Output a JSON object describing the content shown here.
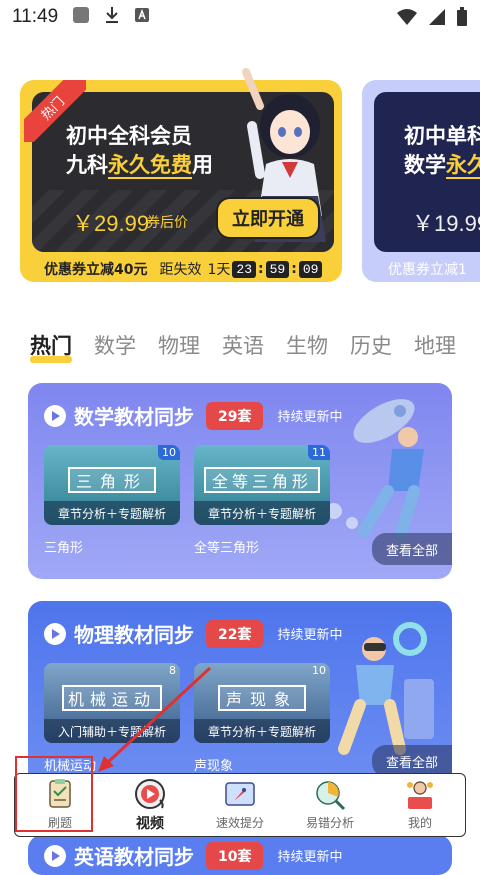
{
  "status": {
    "time": "11:49"
  },
  "membership": {
    "main": {
      "tag": "热门",
      "title_line1": "初中全科会员",
      "title_line2_prefix": "九科",
      "title_line2_highlight": "永久免费",
      "title_line2_suffix": "用",
      "price": "￥29.99",
      "price_note": "券后价",
      "button": "立即开通",
      "coupon": "优惠券立减40元",
      "expire_label": "距失效",
      "countdown_day": "1天",
      "countdown_h": "23",
      "countdown_m": "59",
      "countdown_s": "09"
    },
    "second": {
      "title_line1": "初中单科",
      "title_line2_prefix": "数学",
      "title_line2_highlight": "永久",
      "price": "￥19.99",
      "coupon": "优惠券立减1"
    }
  },
  "tabs": [
    "热门",
    "数学",
    "物理",
    "英语",
    "生物",
    "历史",
    "地理"
  ],
  "sections": {
    "math": {
      "title": "数学教材同步",
      "count": "29套",
      "update": "持续更新中",
      "items": [
        {
          "thumb_title": "三角形",
          "num": "10",
          "sub": "章节分析＋专题解析",
          "label": "三角形"
        },
        {
          "thumb_title": "全等三角形",
          "num": "11",
          "sub": "章节分析＋专题解析",
          "label": "全等三角形"
        }
      ],
      "view_all": "查看全部"
    },
    "physics": {
      "title": "物理教材同步",
      "count": "22套",
      "update": "持续更新中",
      "items": [
        {
          "thumb_title": "机械运动",
          "num": "8",
          "sub": "入门辅助＋专题解析",
          "label": "机械运动"
        },
        {
          "thumb_title": "声现象",
          "num": "10",
          "sub": "章节分析＋专题解析",
          "label": "声现象"
        }
      ],
      "view_all": "查看全部"
    },
    "english": {
      "title": "英语教材同步",
      "count": "10套",
      "update": "持续更新中"
    }
  },
  "nav": {
    "items": [
      {
        "label": "刷题",
        "icon": "clipboard-check-icon"
      },
      {
        "label": "视频",
        "icon": "video-disc-icon"
      },
      {
        "label": "速效提分",
        "icon": "rocket-board-icon"
      },
      {
        "label": "易错分析",
        "icon": "magnifier-chart-icon"
      },
      {
        "label": "我的",
        "icon": "profile-podium-icon"
      }
    ]
  },
  "colors": {
    "accent_yellow": "#f9cf3a",
    "badge_red": "#e54848",
    "math_blue": "#7f87f0",
    "physics_blue": "#4f75ec",
    "annotation_red": "#e03030"
  }
}
